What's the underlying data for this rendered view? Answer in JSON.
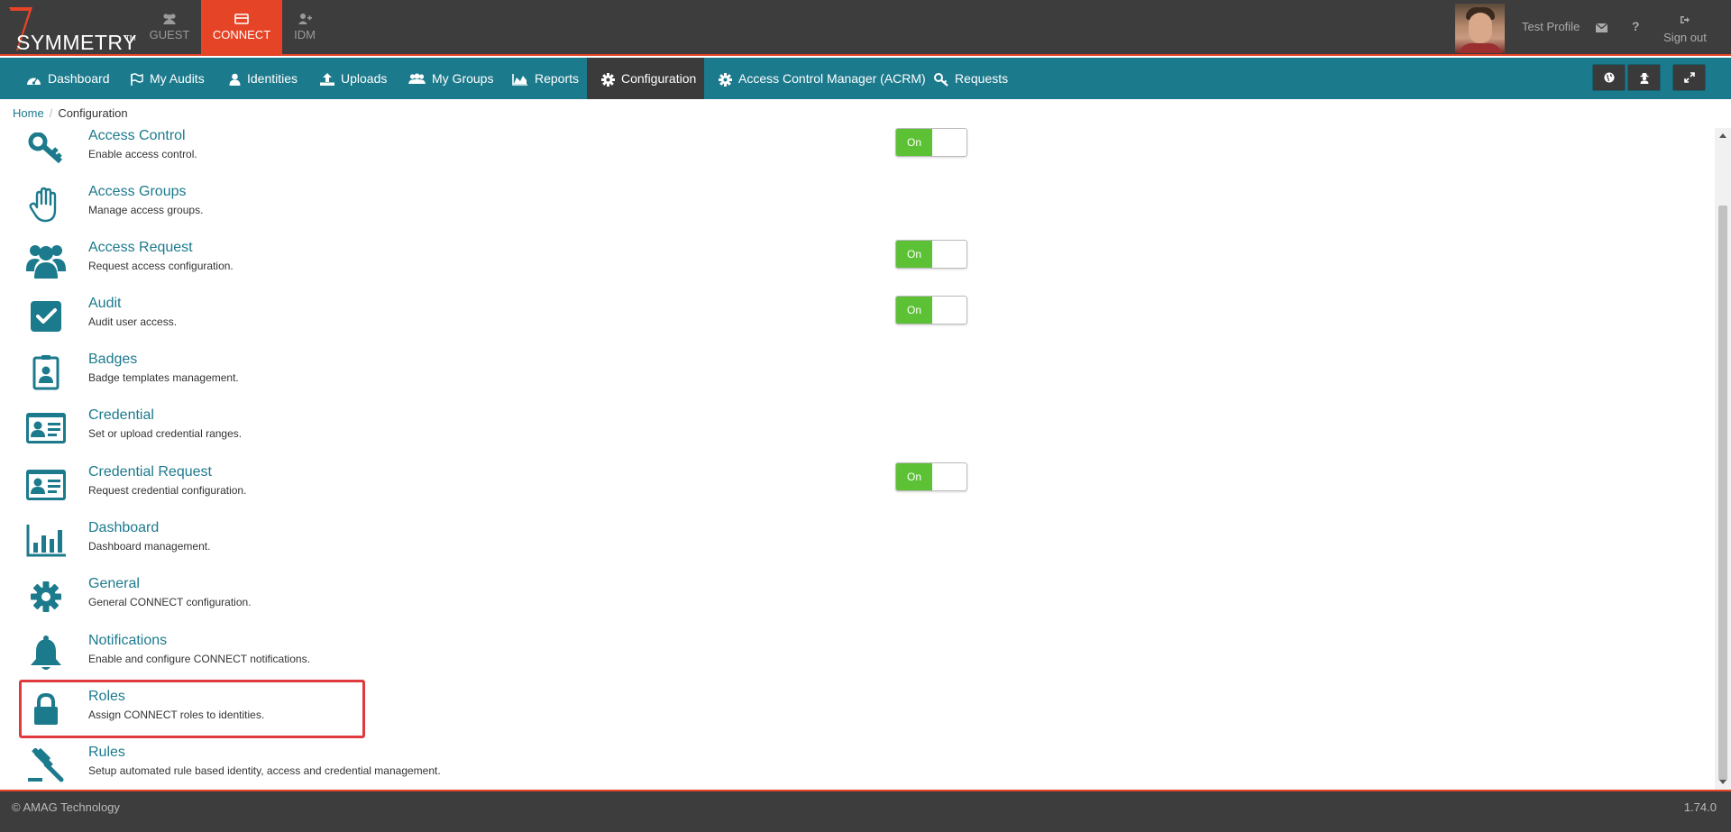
{
  "brand": {
    "logo_text": "SYMMETRY",
    "logo_tm": "TM"
  },
  "app_tabs": [
    {
      "label": "GUEST",
      "icon": "users-icon"
    },
    {
      "label": "CONNECT",
      "icon": "card-icon"
    },
    {
      "label": "IDM",
      "icon": "user-plus-icon"
    }
  ],
  "user": {
    "name": "Test Profile",
    "sign_out": "Sign out",
    "help": "?"
  },
  "nav": {
    "items": [
      {
        "label": "Dashboard",
        "icon": "dashboard-icon"
      },
      {
        "label": "My Audits",
        "icon": "flag-icon"
      },
      {
        "label": "Identities",
        "icon": "user-icon"
      },
      {
        "label": "Uploads",
        "icon": "upload-icon"
      },
      {
        "label": "My Groups",
        "icon": "users-icon"
      },
      {
        "label": "Reports",
        "icon": "area-chart-icon"
      },
      {
        "label": "Configuration",
        "icon": "gear-icon"
      },
      {
        "label": "Access Control Manager (ACRM)",
        "icon": "gear-icon"
      },
      {
        "label": "Requests",
        "icon": "key-icon"
      }
    ],
    "buttons": [
      "globe-icon",
      "user-secret-icon",
      "expand-icon"
    ]
  },
  "breadcrumb": {
    "home": "Home",
    "current": "Configuration"
  },
  "config_items": [
    {
      "title": "Access Control",
      "desc": "Enable access control.",
      "icon": "key-icon",
      "toggle": "On"
    },
    {
      "title": "Access Groups",
      "desc": "Manage access groups.",
      "icon": "hand-icon",
      "toggle": null
    },
    {
      "title": "Access Request",
      "desc": "Request access configuration.",
      "icon": "users-icon",
      "toggle": "On"
    },
    {
      "title": "Audit",
      "desc": "Audit user access.",
      "icon": "checkbox-icon",
      "toggle": "On"
    },
    {
      "title": "Badges",
      "desc": "Badge templates management.",
      "icon": "badge-icon",
      "toggle": null
    },
    {
      "title": "Credential",
      "desc": "Set or upload credential ranges.",
      "icon": "id-card-icon",
      "toggle": null
    },
    {
      "title": "Credential Request",
      "desc": "Request credential configuration.",
      "icon": "id-card-icon",
      "toggle": "On"
    },
    {
      "title": "Dashboard",
      "desc": "Dashboard management.",
      "icon": "bar-chart-icon",
      "toggle": null
    },
    {
      "title": "General",
      "desc": "General CONNECT configuration.",
      "icon": "gear-icon",
      "toggle": null
    },
    {
      "title": "Notifications",
      "desc": "Enable and configure CONNECT notifications.",
      "icon": "bell-icon",
      "toggle": null
    },
    {
      "title": "Roles",
      "desc": "Assign CONNECT roles to identities.",
      "icon": "lock-icon",
      "toggle": null
    },
    {
      "title": "Rules",
      "desc": "Setup automated rule based identity, access and credential management.",
      "icon": "gavel-icon",
      "toggle": null
    }
  ],
  "footer": {
    "copyright": "© AMAG Technology",
    "version": "1.74.0"
  },
  "colors": {
    "teal": "#1c7a8d",
    "accent_red": "#e64427",
    "toggle_green": "#5cc134",
    "dark": "#3d3d3d"
  }
}
